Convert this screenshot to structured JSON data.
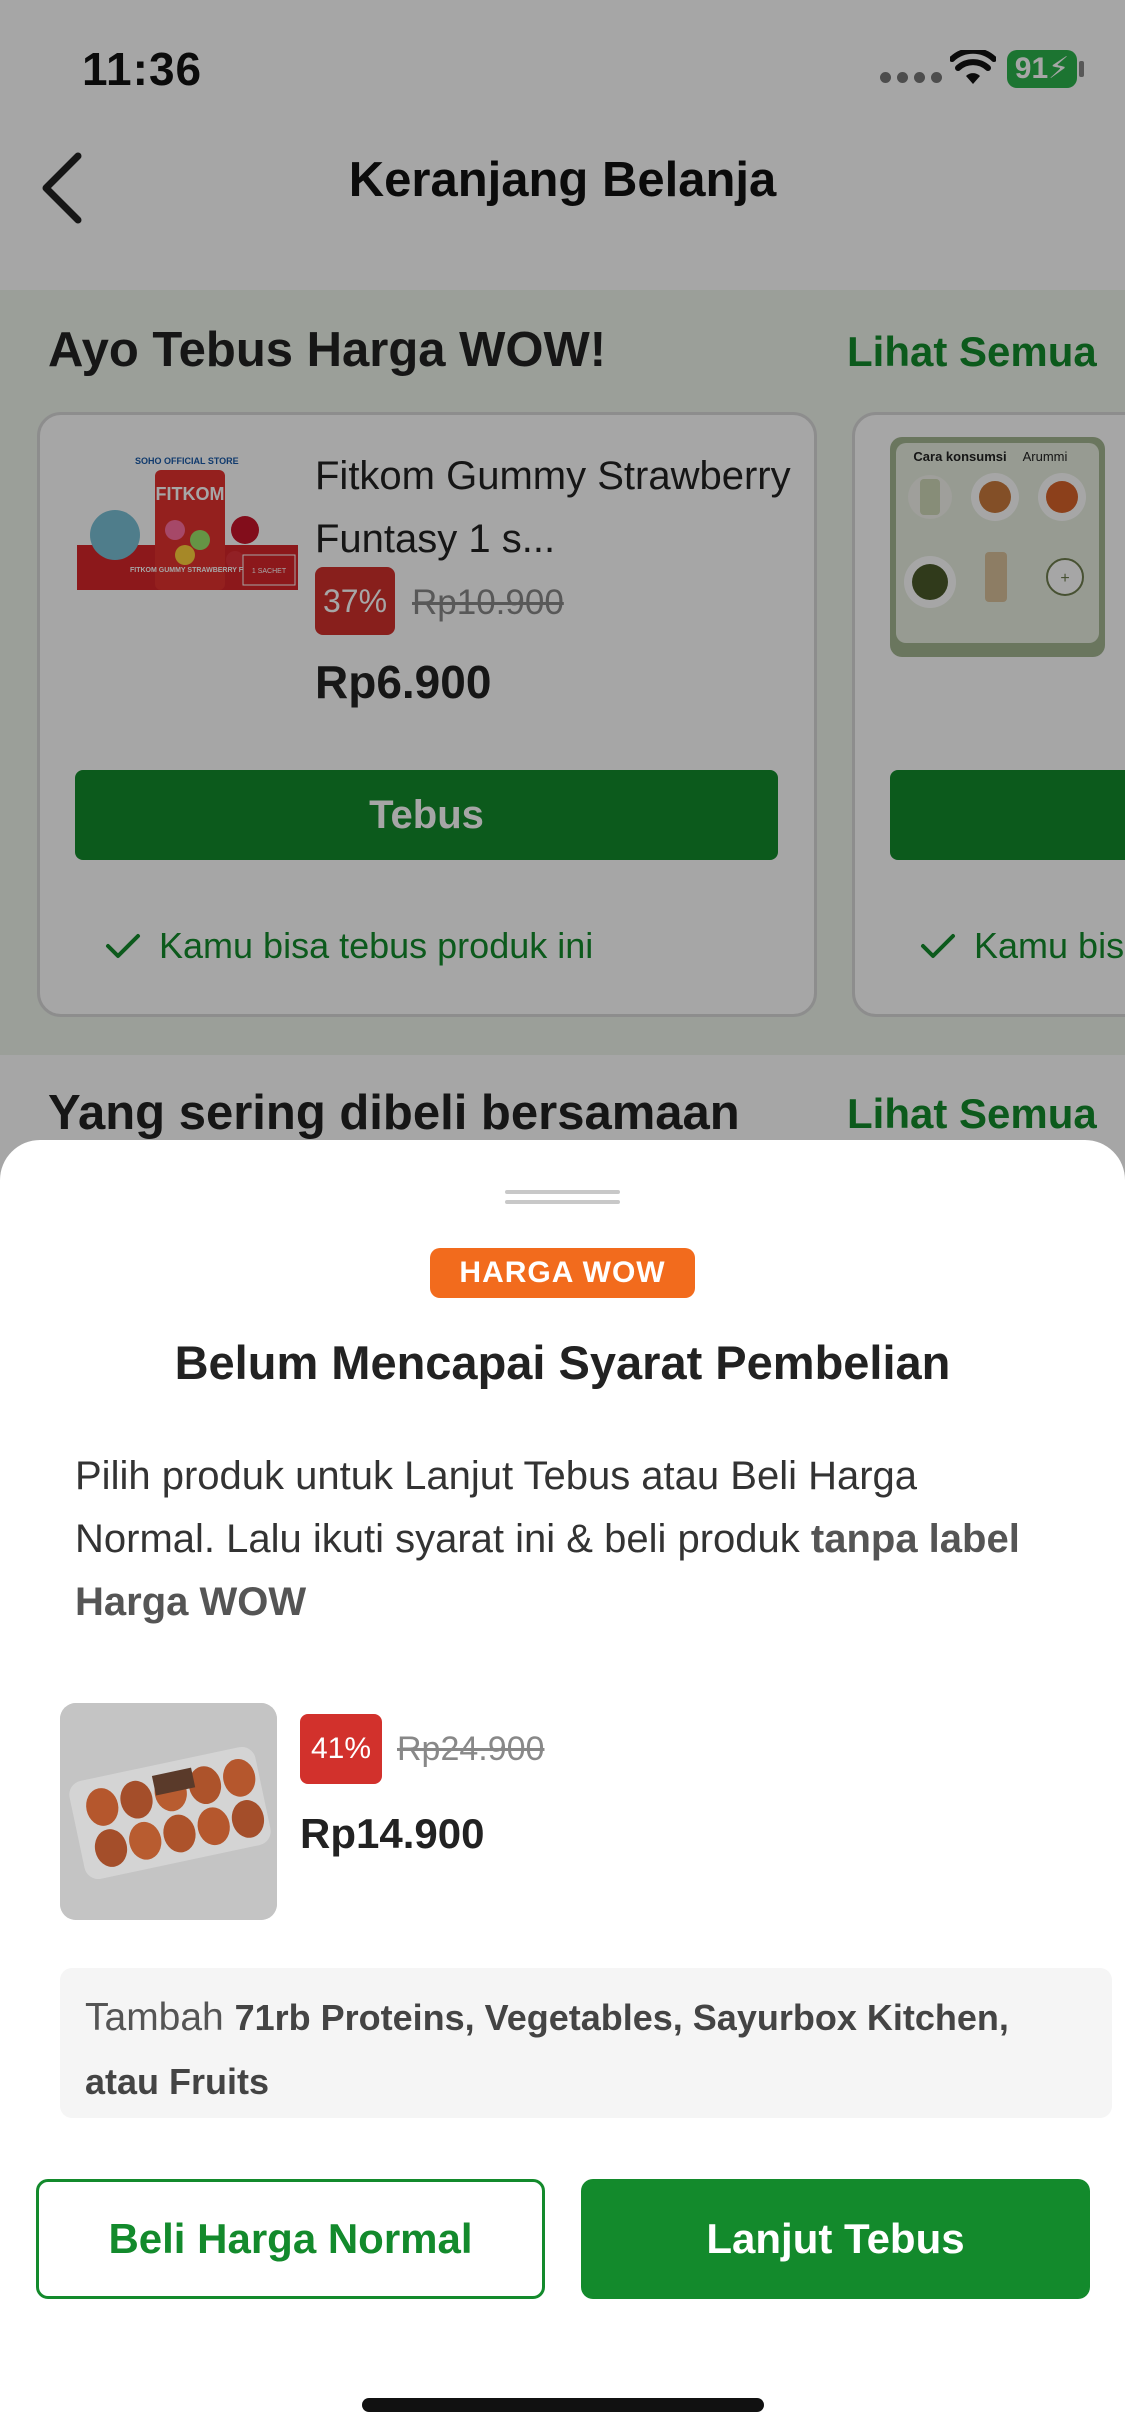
{
  "status_bar": {
    "time": "11:36",
    "battery": "91"
  },
  "nav": {
    "title": "Keranjang Belanja"
  },
  "wow_section": {
    "title": "Ayo Tebus Harga WOW!",
    "see_all": "Lihat Semua",
    "products": [
      {
        "name": "Fitkom Gummy Strawberry Funtasy 1 s...",
        "discount": "37%",
        "original_price": "Rp10.900",
        "price": "Rp6.900",
        "button": "Tebus",
        "note": "Kamu bisa tebus produk ini",
        "image_text": {
          "brand": "FITKOM",
          "store": "SOHO OFFICIAL STORE",
          "label": "FITKOM GUMMY STRAWBERRY FANTASY",
          "sachet": "1 SACHET"
        }
      },
      {
        "name": "",
        "button": "",
        "note": "Kamu bisa",
        "image_text": {
          "title": "Cara konsumsi",
          "brand": "Arummi"
        }
      }
    ]
  },
  "bought_together": {
    "title": "Yang sering dibeli bersamaan",
    "see_all": "Lihat Semua"
  },
  "sheet": {
    "badge": "HARGA WOW",
    "title": "Belum Mencapai Syarat Pembelian",
    "desc_plain": "Pilih produk untuk Lanjut Tebus atau Beli Harga Normal. Lalu ikuti syarat ini & beli produk ",
    "desc_bold": "tanpa label Harga WOW",
    "item": {
      "discount": "41%",
      "original_price": "Rp24.900",
      "price": "Rp14.900"
    },
    "requirement_plain": "Tambah ",
    "requirement_bold": "71rb Proteins, Vegetables, Sayurbox Kitchen, atau Fruits",
    "btn_normal": "Beli Harga Normal",
    "btn_continue": "Lanjut Tebus"
  },
  "colors": {
    "primary_green": "#138a2c",
    "discount_red": "#d2312c",
    "wow_orange": "#f26b1d"
  }
}
